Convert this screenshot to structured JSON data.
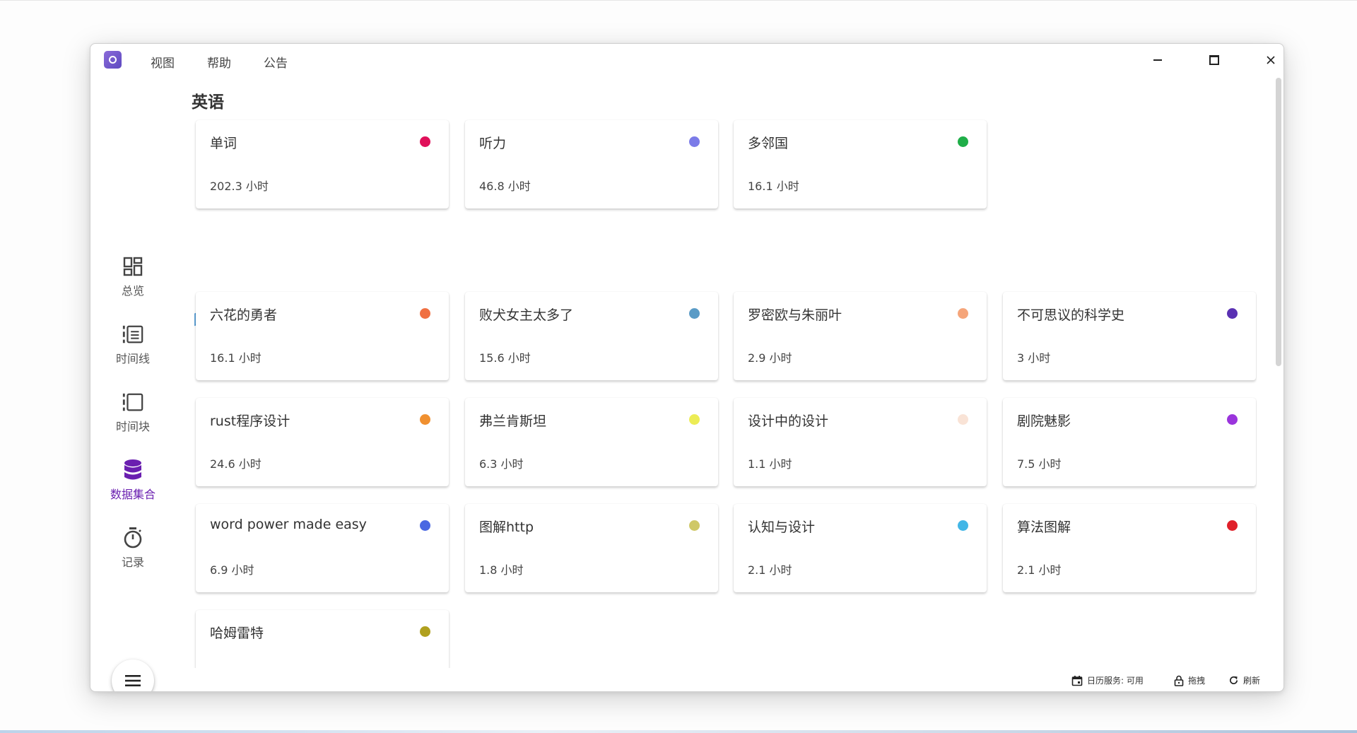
{
  "menu": {
    "view": "视图",
    "help": "帮助",
    "notice": "公告"
  },
  "sidebar": {
    "items": [
      {
        "label": "总览",
        "icon": "dashboard-icon"
      },
      {
        "label": "时间线",
        "icon": "timeline-icon"
      },
      {
        "label": "时间块",
        "icon": "time-block-icon"
      },
      {
        "label": "数据集合",
        "icon": "database-icon",
        "active": true
      },
      {
        "label": "记录",
        "icon": "timer-icon"
      }
    ],
    "menu_button_icon": "hamburger-menu-icon"
  },
  "sections": [
    {
      "title": "英语",
      "cards": [
        {
          "name": "单词",
          "hours": "202.3 小时",
          "color": "#e0105a"
        },
        {
          "name": "听力",
          "hours": "46.8 小时",
          "color": "#7b7be8"
        },
        {
          "name": "多邻国",
          "hours": "16.1 小时",
          "color": "#1fae48"
        }
      ]
    },
    {
      "title_icon": "open-book-icon",
      "cards": [
        {
          "name": "六花的勇者",
          "hours": "16.1 小时",
          "color": "#f07042"
        },
        {
          "name": "败犬女主太多了",
          "hours": "15.6 小时",
          "color": "#5a9bc6"
        },
        {
          "name": "罗密欧与朱丽叶",
          "hours": "2.9 小时",
          "color": "#f5a57a"
        },
        {
          "name": "不可思议的科学史",
          "hours": "3 小时",
          "color": "#5a31b3"
        },
        {
          "name": "rust程序设计",
          "hours": "24.6 小时",
          "color": "#f09030"
        },
        {
          "name": "弗兰肯斯坦",
          "hours": "6.3 小时",
          "color": "#ecec55"
        },
        {
          "name": "设计中的设计",
          "hours": "1.1 小时",
          "color": "#f9e3d6"
        },
        {
          "name": "剧院魅影",
          "hours": "7.5 小时",
          "color": "#9a34dc"
        },
        {
          "name": "word power made easy",
          "hours": "6.9 小时",
          "color": "#4a68e2"
        },
        {
          "name": "图解http",
          "hours": "1.8 小时",
          "color": "#cfc867"
        },
        {
          "name": "认知与设计",
          "hours": "2.1 小时",
          "color": "#42b6e6"
        },
        {
          "name": "算法图解",
          "hours": "2.1 小时",
          "color": "#e0202a"
        },
        {
          "name": "哈姆雷特",
          "hours": "",
          "color": "#b0a01e"
        }
      ]
    }
  ],
  "status": {
    "calendar": {
      "label": "日历服务: 可用",
      "icon": "calendar-icon"
    },
    "drag": {
      "label": "拖拽",
      "icon": "lock-icon"
    },
    "refresh": {
      "label": "刷新",
      "icon": "refresh-icon"
    }
  }
}
